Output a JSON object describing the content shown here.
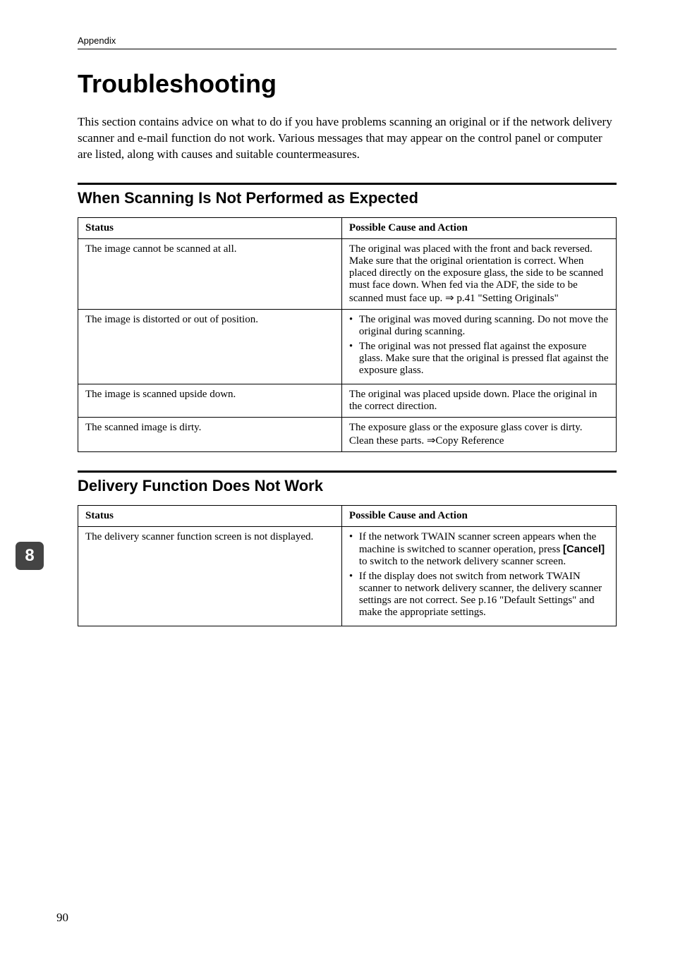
{
  "header_label": "Appendix",
  "title": "Troubleshooting",
  "intro": "This section contains advice on what to do if you have problems scanning an original or if the network delivery scanner and e-mail function do not work. Various messages that may appear on the control panel or computer are listed, along with causes and suitable countermeasures.",
  "section1": {
    "heading": "When Scanning Is Not Performed as Expected",
    "col_status": "Status",
    "col_action": "Possible Cause and Action",
    "rows": [
      {
        "status": "The image cannot be scanned at all.",
        "action_plain": "The original was placed with the front and back reversed. Make sure that the original orientation is correct. When placed directly on the exposure glass, the side to be scanned must face down. When fed via the ADF, the side to be scanned must face up. ⇒ p.41 \"Setting Originals\""
      },
      {
        "status": "The image is distorted or out of position.",
        "action_bullets": [
          "The original was moved during scanning. Do not move the original during scanning.",
          "The original was not pressed flat against the exposure glass. Make sure that the original is pressed flat against the exposure glass."
        ]
      },
      {
        "status": "The image is scanned upside down.",
        "action_plain": "The original was placed upside down. Place the original in the correct direction."
      },
      {
        "status": "The scanned image is dirty.",
        "action_plain": "The exposure glass or the exposure glass cover is dirty. Clean these parts. ⇒Copy Reference"
      }
    ]
  },
  "section2": {
    "heading": "Delivery Function Does Not Work",
    "col_status": "Status",
    "col_action": "Possible Cause and Action",
    "rows": [
      {
        "status": "The delivery scanner function screen is not displayed.",
        "action_bullets_rich": [
          {
            "pre": "If the network TWAIN scanner screen appears when the machine is switched to scanner operation, press ",
            "bold": "[Cancel]",
            "post": " to switch to the network delivery scanner screen."
          },
          {
            "plain": "If the display does not switch from network TWAIN scanner to network delivery scanner, the delivery scanner settings are not correct. See p.16 \"Default Settings\" and make the appropriate settings."
          }
        ]
      }
    ]
  },
  "side_tab": "8",
  "page_number": "90"
}
